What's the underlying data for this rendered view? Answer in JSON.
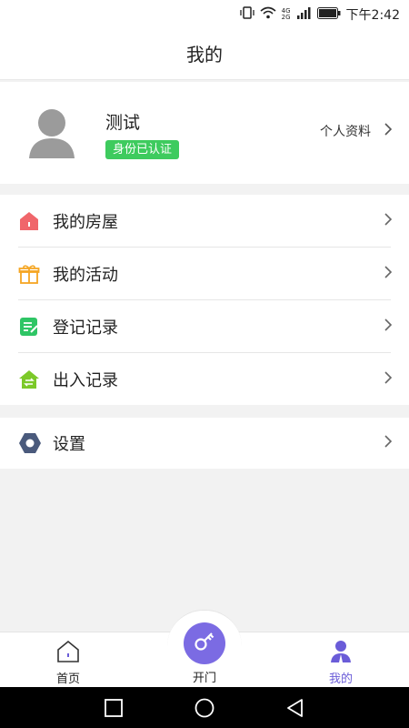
{
  "status_bar": {
    "time": "下午2:42",
    "network_top": "4G",
    "network_bottom": "2G"
  },
  "header": {
    "title": "我的"
  },
  "profile": {
    "name": "测试",
    "badge": "身份已认证",
    "link_label": "个人资料"
  },
  "menu": {
    "group1": [
      {
        "label": "我的房屋",
        "icon": "house-icon",
        "color": "#f0666b"
      },
      {
        "label": "我的活动",
        "icon": "gift-icon",
        "color": "#f5a623"
      },
      {
        "label": "登记记录",
        "icon": "document-icon",
        "color": "#2ec565"
      },
      {
        "label": "出入记录",
        "icon": "house-arrows-icon",
        "color": "#7cc929"
      }
    ],
    "group2": [
      {
        "label": "设置",
        "icon": "hexagon-settings-icon",
        "color": "#4a5a7c"
      }
    ]
  },
  "tabbar": {
    "home": "首页",
    "open": "开门",
    "me": "我的"
  },
  "colors": {
    "accent": "#7b6be3",
    "badge": "#3ecb5e"
  }
}
